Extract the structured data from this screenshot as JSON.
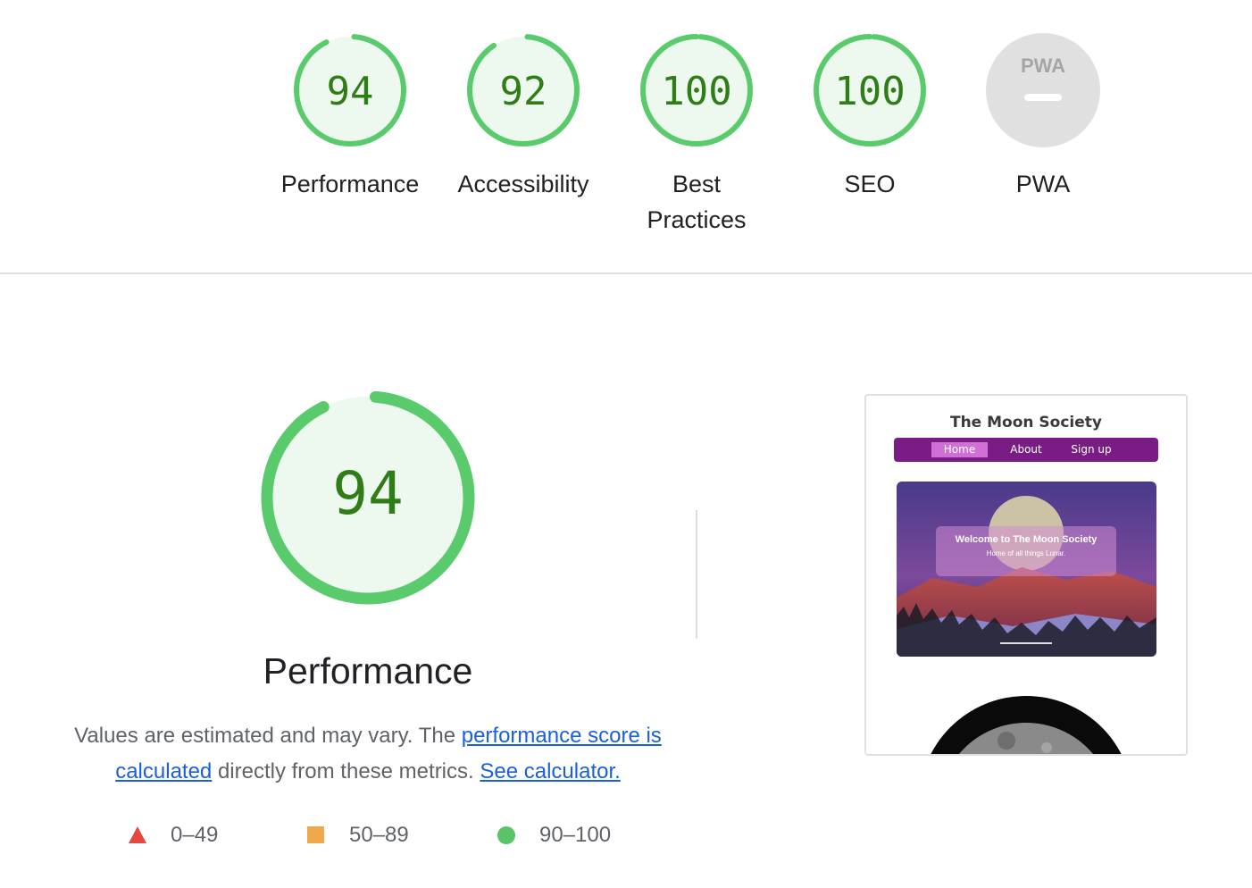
{
  "categories": [
    {
      "label": "Performance",
      "score": 94,
      "type": "score"
    },
    {
      "label": "Accessibility",
      "score": 92,
      "type": "score"
    },
    {
      "label": "Best Practices",
      "score": 100,
      "type": "score"
    },
    {
      "label": "SEO",
      "score": 100,
      "type": "score"
    },
    {
      "label": "PWA",
      "score": null,
      "type": "pwa",
      "badge_text": "PWA",
      "badge_value": "—"
    }
  ],
  "detail": {
    "score": 94,
    "title": "Performance",
    "description_start": "Values are estimated and may vary. The ",
    "link_score": "performance score is calculated",
    "description_mid": " directly from these metrics. ",
    "link_calculator": "See calculator."
  },
  "legend": [
    {
      "range": "0–49",
      "shape": "triangle",
      "color": "#e5483c"
    },
    {
      "range": "50–89",
      "shape": "square",
      "color": "#f1a84a"
    },
    {
      "range": "90–100",
      "shape": "circle",
      "color": "#58c46a"
    }
  ],
  "screenshot": {
    "site_title": "The Moon Society",
    "nav": [
      "Home",
      "About",
      "Sign up"
    ],
    "hero_heading": "Welcome to The Moon Society",
    "hero_subtitle": "Home of all things Lunar."
  },
  "colors": {
    "pass_ring": "#5acb6c",
    "pass_fill": "#edf8ef",
    "pass_text": "#2e7d16",
    "pwa_gray": "#e0e0e0",
    "link": "#1a5fe0",
    "nav_bg": "#7a1c86"
  }
}
